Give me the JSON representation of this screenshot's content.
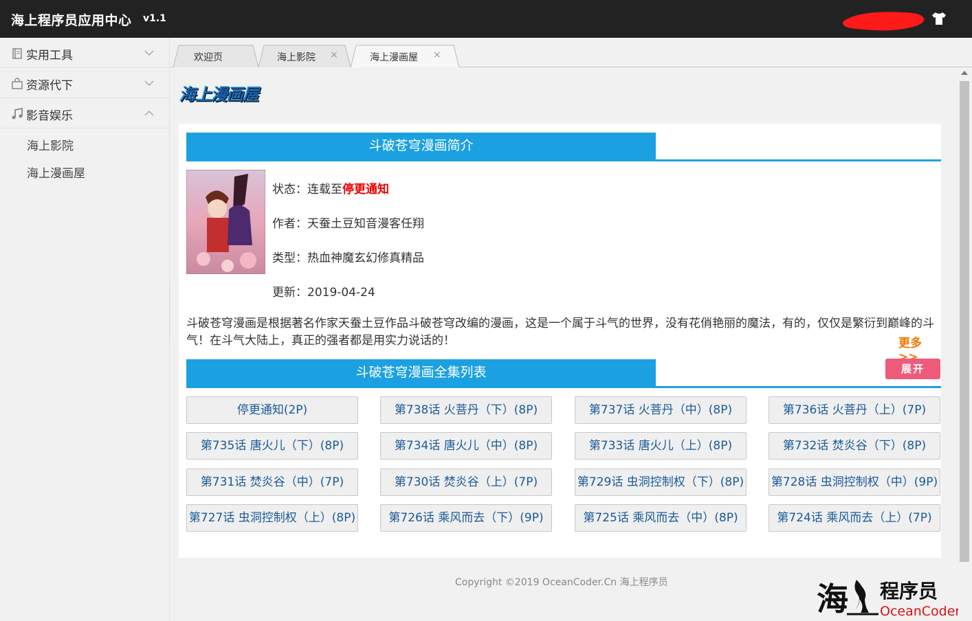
{
  "app": {
    "title": "海上程序员应用中心",
    "version": "v1.1"
  },
  "sidebar": {
    "groups": [
      {
        "label": "实用工具",
        "icon": "book-icon",
        "expanded": false
      },
      {
        "label": "资源代下",
        "icon": "bag-icon",
        "expanded": false
      },
      {
        "label": "影音娱乐",
        "icon": "music-note-icon",
        "expanded": true
      }
    ],
    "sub_items": [
      "海上影院",
      "海上漫画屋"
    ]
  },
  "tabs": [
    {
      "label": "欢迎页",
      "closable": false,
      "active": false
    },
    {
      "label": "海上影院",
      "closable": true,
      "active": false
    },
    {
      "label": "海上漫画屋",
      "closable": true,
      "active": true
    }
  ],
  "tab_close_glyph": "×",
  "page": {
    "logo_title": "海上漫画屋",
    "intro_heading": "斗破苍穹漫画简介",
    "info": {
      "status_label": "状态：",
      "status_prefix": "连载至",
      "status_value": "停更通知",
      "author_label": "作者：",
      "author_value": "天蚕土豆知音漫客任翔",
      "type_label": "类型：",
      "type_value": "热血神魔玄幻修真精品",
      "update_label": "更新：",
      "update_value": "2019-04-24"
    },
    "description": "斗破苍穹漫画是根据著名作家天蚕土豆作品斗破苍穹改编的漫画，这是一个属于斗气的世界，没有花俏艳丽的魔法，有的，仅仅是繁衍到巅峰的斗气！在斗气大陆上，真正的强者都是用实力说话的！",
    "more_label": "更多>>",
    "list_heading": "斗破苍穹漫画全集列表",
    "expand_label": "展开",
    "episodes": [
      "停更通知(2P)",
      "第738话 火菩丹（下）(8P)",
      "第737话 火菩丹（中）(8P)",
      "第736话 火菩丹（上）(7P)",
      "第735话 唐火儿（下）(8P)",
      "第734话 唐火儿（中）(8P)",
      "第733话 唐火儿（上）(8P)",
      "第732话 焚炎谷（下）(8P)",
      "第731话 焚炎谷（中）(7P)",
      "第730话 焚炎谷（上）(7P)",
      "第729话 虫洞控制权（下）(8P)",
      "第728话 虫洞控制权（中）(9P)",
      "第727话 虫洞控制权（上）(8P)",
      "第726话 乘风而去（下）(9P)",
      "第725话 乘风而去（中）(8P)",
      "第724话 乘风而去（上）(7P)"
    ]
  },
  "footer": {
    "copyright": "Copyright ©2019 OceanCoder.Cn  海上程序员",
    "logo_cn": "海",
    "logo_cn_2": "程序员",
    "logo_en": "OceanCoder.cn"
  },
  "colors": {
    "accent": "#1ba1e2",
    "topbar": "#222222",
    "expand": "#ef5b7b",
    "more": "#f07800"
  }
}
